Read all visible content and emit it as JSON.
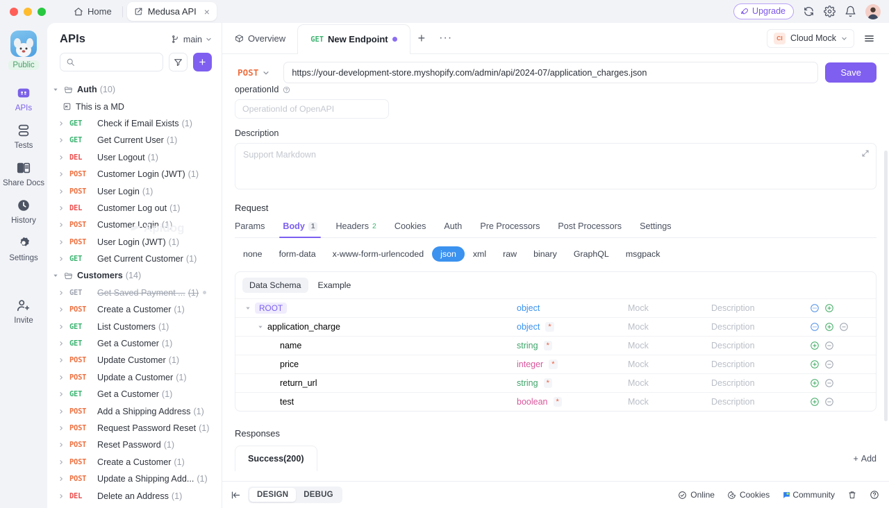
{
  "titlebar": {
    "home_label": "Home",
    "tab_label": "Medusa API",
    "tab_close": "×",
    "upgrade_label": "Upgrade"
  },
  "rail": {
    "workspace_label": "Public",
    "items": [
      {
        "label": "APIs",
        "icon": "apis-icon",
        "active": true
      },
      {
        "label": "Tests",
        "icon": "tests-icon",
        "active": false
      },
      {
        "label": "Share Docs",
        "icon": "share-docs-icon",
        "active": false
      },
      {
        "label": "History",
        "icon": "history-icon",
        "active": false
      },
      {
        "label": "Settings",
        "icon": "settings-icon",
        "active": false
      },
      {
        "label": "Invite",
        "icon": "invite-icon",
        "active": false
      }
    ]
  },
  "apis_panel": {
    "title": "APIs",
    "branch": "main",
    "search_placeholder": "",
    "search_value": "",
    "add_label": "+",
    "watermark": "Apidog",
    "tree": [
      {
        "kind": "folder",
        "name": "Auth",
        "count": "(10)",
        "expanded": true
      },
      {
        "kind": "md",
        "name": "This is a MD"
      },
      {
        "kind": "api",
        "method": "GET",
        "name": "Check if Email Exists",
        "count": "(1)"
      },
      {
        "kind": "api",
        "method": "GET",
        "name": "Get Current User",
        "count": "(1)"
      },
      {
        "kind": "api",
        "method": "DEL",
        "name": "User Logout",
        "count": "(1)"
      },
      {
        "kind": "api",
        "method": "POST",
        "name": "Customer Login (JWT)",
        "count": "(1)"
      },
      {
        "kind": "api",
        "method": "POST",
        "name": "User Login",
        "count": "(1)"
      },
      {
        "kind": "api",
        "method": "DEL",
        "name": "Customer Log out",
        "count": "(1)"
      },
      {
        "kind": "api",
        "method": "POST",
        "name": "Customer Login",
        "count": "(1)"
      },
      {
        "kind": "api",
        "method": "POST",
        "name": "User Login (JWT)",
        "count": "(1)"
      },
      {
        "kind": "api",
        "method": "GET",
        "name": "Get Current Customer",
        "count": "(1)"
      },
      {
        "kind": "folder",
        "name": "Customers",
        "count": "(14)",
        "expanded": true
      },
      {
        "kind": "api",
        "method": "GET",
        "name": "Get Saved Payment ...",
        "count": "(1)",
        "deprecated": true
      },
      {
        "kind": "api",
        "method": "POST",
        "name": "Create a Customer",
        "count": "(1)"
      },
      {
        "kind": "api",
        "method": "GET",
        "name": "List Customers",
        "count": "(1)"
      },
      {
        "kind": "api",
        "method": "GET",
        "name": "Get a Customer",
        "count": "(1)"
      },
      {
        "kind": "api",
        "method": "POST",
        "name": "Update Customer",
        "count": "(1)"
      },
      {
        "kind": "api",
        "method": "POST",
        "name": "Update a Customer",
        "count": "(1)"
      },
      {
        "kind": "api",
        "method": "GET",
        "name": "Get a Customer",
        "count": "(1)"
      },
      {
        "kind": "api",
        "method": "POST",
        "name": "Add a Shipping Address",
        "count": "(1)"
      },
      {
        "kind": "api",
        "method": "POST",
        "name": "Request Password Reset",
        "count": "(1)"
      },
      {
        "kind": "api",
        "method": "POST",
        "name": "Reset Password",
        "count": "(1)"
      },
      {
        "kind": "api",
        "method": "POST",
        "name": "Create a Customer",
        "count": "(1)"
      },
      {
        "kind": "api",
        "method": "POST",
        "name": "Update a Shipping Add...",
        "count": "(1)"
      },
      {
        "kind": "api",
        "method": "DEL",
        "name": "Delete an Address",
        "count": "(1)"
      }
    ]
  },
  "content": {
    "tabs": [
      {
        "label": "Overview",
        "method": "",
        "active": false,
        "dirty": false
      },
      {
        "label": "New Endpoint",
        "method": "GET",
        "active": true,
        "dirty": true
      }
    ],
    "new_tab_label": "+",
    "more_tabs_label": "···",
    "environment": {
      "badge": "CI",
      "label": "Cloud Mock"
    },
    "request_line": {
      "method": "POST",
      "url": "https://your-development-store.myshopify.com/admin/api/2024-07/application_charges.json",
      "save_label": "Save"
    },
    "operation_id": {
      "label": "operationId",
      "placeholder": "OperationId of OpenAPI",
      "value": ""
    },
    "description": {
      "label": "Description",
      "placeholder": "Support Markdown",
      "value": ""
    },
    "request": {
      "title": "Request",
      "tabs": [
        {
          "label": "Params",
          "badge": "",
          "active": false
        },
        {
          "label": "Body",
          "badge": "1",
          "active": true
        },
        {
          "label": "Headers",
          "badge": "2",
          "active": false
        },
        {
          "label": "Cookies",
          "badge": "",
          "active": false
        },
        {
          "label": "Auth",
          "badge": "",
          "active": false
        },
        {
          "label": "Pre Processors",
          "badge": "",
          "active": false
        },
        {
          "label": "Post Processors",
          "badge": "",
          "active": false
        },
        {
          "label": "Settings",
          "badge": "",
          "active": false
        }
      ],
      "body_types": [
        {
          "label": "none",
          "active": false
        },
        {
          "label": "form-data",
          "active": false
        },
        {
          "label": "x-www-form-urlencoded",
          "active": false
        },
        {
          "label": "json",
          "active": true
        },
        {
          "label": "xml",
          "active": false
        },
        {
          "label": "raw",
          "active": false
        },
        {
          "label": "binary",
          "active": false
        },
        {
          "label": "GraphQL",
          "active": false
        },
        {
          "label": "msgpack",
          "active": false
        }
      ],
      "schema_tabs": [
        {
          "label": "Data Schema",
          "active": true
        },
        {
          "label": "Example",
          "active": false
        }
      ],
      "schema_rows": [
        {
          "name": "ROOT",
          "root": true,
          "indent": 0,
          "caret": true,
          "type": "object",
          "required": false,
          "mock": "Mock",
          "description": "Description",
          "actions": [
            "more",
            "add"
          ]
        },
        {
          "name": "application_charge",
          "root": false,
          "indent": 1,
          "caret": true,
          "type": "object",
          "required": true,
          "mock": "Mock",
          "description": "Description",
          "actions": [
            "more",
            "add",
            "remove"
          ]
        },
        {
          "name": "name",
          "root": false,
          "indent": 2,
          "caret": false,
          "type": "string",
          "required": true,
          "mock": "Mock",
          "description": "Description",
          "actions": [
            "add",
            "remove"
          ]
        },
        {
          "name": "price",
          "root": false,
          "indent": 2,
          "caret": false,
          "type": "integer",
          "required": true,
          "mock": "Mock",
          "description": "Description",
          "actions": [
            "add",
            "remove"
          ]
        },
        {
          "name": "return_url",
          "root": false,
          "indent": 2,
          "caret": false,
          "type": "string",
          "required": true,
          "mock": "Mock",
          "description": "Description",
          "actions": [
            "add",
            "remove"
          ]
        },
        {
          "name": "test",
          "root": false,
          "indent": 2,
          "caret": false,
          "type": "boolean",
          "required": true,
          "mock": "Mock",
          "description": "Description",
          "actions": [
            "add",
            "remove"
          ]
        }
      ]
    },
    "responses": {
      "title": "Responses",
      "tabs": [
        {
          "label": "Success(200)",
          "active": true
        }
      ],
      "add_label": "Add"
    }
  },
  "statusbar": {
    "modes": [
      {
        "label": "DESIGN",
        "active": true
      },
      {
        "label": "DEBUG",
        "active": false
      }
    ],
    "items": [
      {
        "label": "Online",
        "icon": "online-icon"
      },
      {
        "label": "Cookies",
        "icon": "cookie-icon"
      },
      {
        "label": "Community",
        "icon": "community-icon"
      }
    ]
  },
  "colors": {
    "accent": "#7f5ff0",
    "get": "#3cb371",
    "post": "#ee7040",
    "del": "#ec4f4f",
    "json_pill": "#3b92ef",
    "required": "#ef5a3c"
  }
}
